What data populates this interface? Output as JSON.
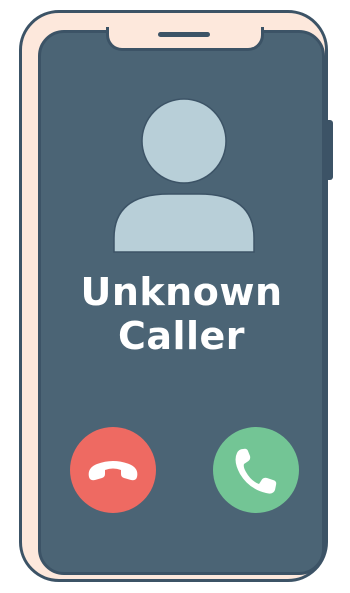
{
  "caller": {
    "name_line1": "Unknown",
    "name_line2": "Caller",
    "avatar_icon": "person-silhouette-icon"
  },
  "actions": {
    "decline_icon": "hang-up-phone-icon",
    "accept_icon": "phone-icon"
  },
  "colors": {
    "frame": "#fde8dc",
    "outline": "#3c5366",
    "screen": "#4b6475",
    "avatar": "#b8cfd8",
    "decline": "#ee6a62",
    "accept": "#73c595",
    "text": "#ffffff"
  }
}
